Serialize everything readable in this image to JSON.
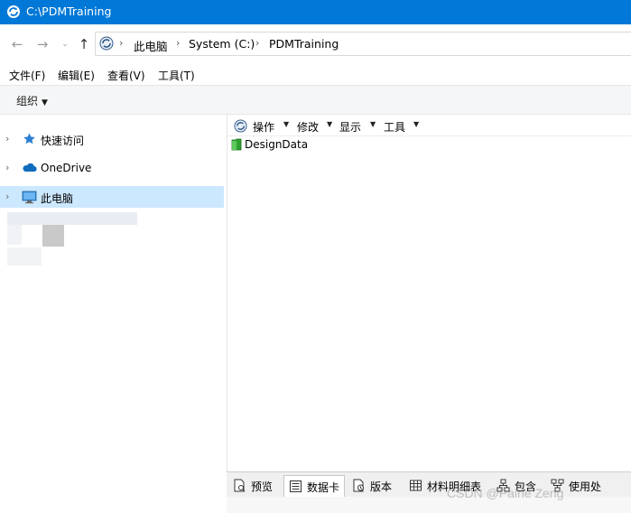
{
  "window": {
    "title": "C:\\PDMTraining"
  },
  "breadcrumb": [
    "此电脑",
    "System (C:)",
    "PDMTraining"
  ],
  "menubar": [
    "文件(F)",
    "编辑(E)",
    "查看(V)",
    "工具(T)"
  ],
  "command_bar": {
    "organize_label": "组织"
  },
  "nav_tree": [
    {
      "label": "快速访问",
      "icon": "star-icon"
    },
    {
      "label": "OneDrive",
      "icon": "cloud-icon"
    },
    {
      "label": "此电脑",
      "icon": "computer-icon",
      "selected": true
    }
  ],
  "pdm_toolbar": [
    "操作",
    "修改",
    "显示",
    "工具"
  ],
  "files": [
    {
      "name": "DesignData",
      "icon": "vault-folder-icon"
    }
  ],
  "tabs": [
    {
      "label": "预览",
      "icon": "preview-icon"
    },
    {
      "label": "数据卡",
      "icon": "datacard-icon",
      "active": true
    },
    {
      "label": "版本",
      "icon": "version-icon"
    },
    {
      "label": "材料明细表",
      "icon": "bom-icon"
    },
    {
      "label": "包含",
      "icon": "contains-icon"
    },
    {
      "label": "使用处",
      "icon": "where-used-icon"
    }
  ],
  "watermark": "CSDN @Paine Zeng",
  "colors": {
    "titlebar": "#0078d7",
    "selection": "#cce8ff"
  }
}
